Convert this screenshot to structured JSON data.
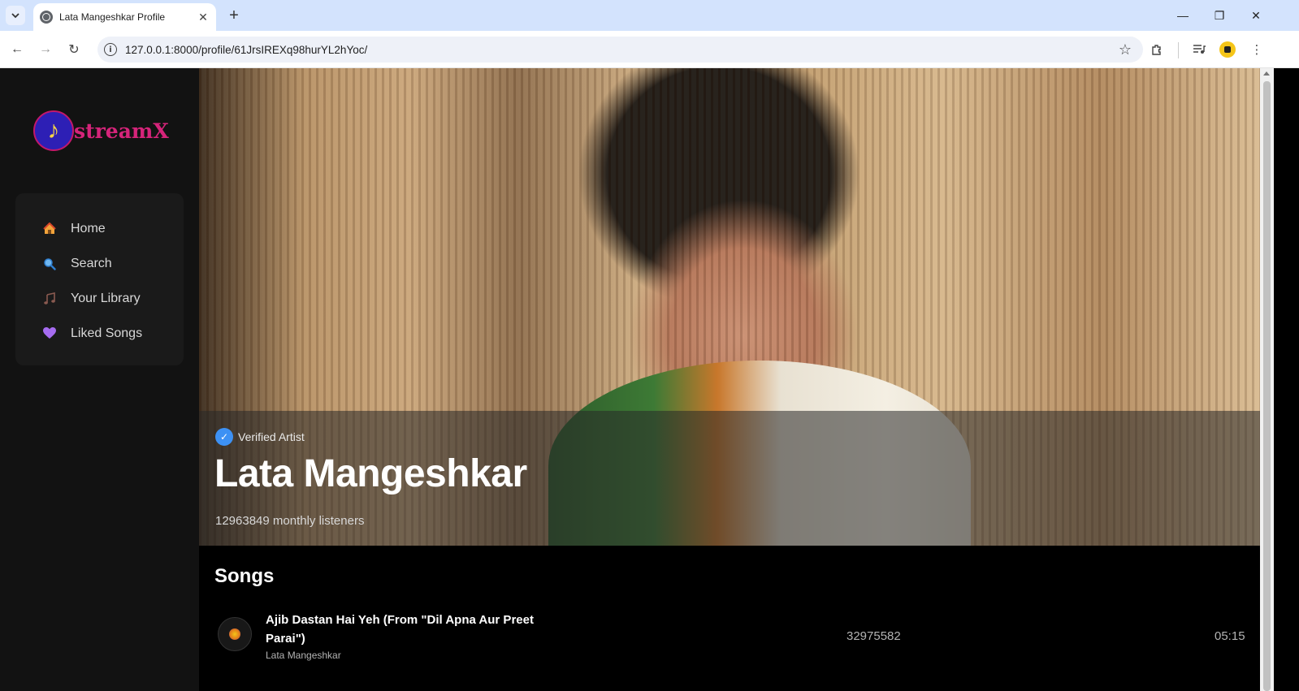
{
  "browser": {
    "tab_title": "Lata Mangeshkar Profile",
    "url": "127.0.0.1:8000/profile/61JrsIREXq98hurYL2hYoc/"
  },
  "app": {
    "logo_text": "streamX",
    "nav": [
      {
        "label": "Home",
        "icon": "house-icon"
      },
      {
        "label": "Search",
        "icon": "magnifier-icon"
      },
      {
        "label": "Your Library",
        "icon": "music-note-icon"
      },
      {
        "label": "Liked Songs",
        "icon": "purple-heart-icon"
      }
    ]
  },
  "artist": {
    "verified_label": "Verified Artist",
    "name": "Lata Mangeshkar",
    "listeners": "12963849 monthly listeners"
  },
  "songs": {
    "heading": "Songs",
    "items": [
      {
        "title": "Ajib Dastan Hai Yeh (From \"Dil Apna Aur Preet Parai\")",
        "artist": "Lata Mangeshkar",
        "plays": "32975582",
        "duration": "05:15"
      }
    ]
  },
  "colors": {
    "accent_pink": "#d6247a",
    "logo_blue": "#2d1fb5",
    "verified_blue": "#3d91f4",
    "sidebar_bg": "#121212"
  }
}
